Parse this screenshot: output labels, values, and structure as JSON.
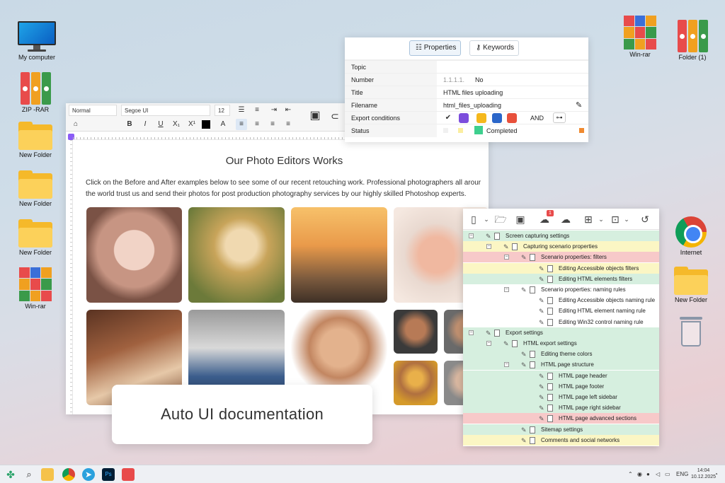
{
  "desktop": {
    "left_icons": [
      {
        "label": "My computer"
      },
      {
        "label": "ZIP -RAR"
      },
      {
        "label": "New Folder"
      },
      {
        "label": "New Folder"
      },
      {
        "label": "New Folder"
      },
      {
        "label": "Win-rar"
      }
    ],
    "right_icons": [
      {
        "label": "Win-rar"
      },
      {
        "label": "Folder (1)"
      },
      {
        "label": "Internet"
      },
      {
        "label": "New Folder"
      },
      {
        "label": ""
      }
    ]
  },
  "editor": {
    "style_select": "Normal",
    "font_select": "Segoe UI",
    "size_select": "12",
    "format_buttons": [
      "B",
      "I",
      "U",
      "X₁",
      "X¹",
      "A"
    ],
    "doc_title": "Our Photo Editors Works",
    "doc_body_line1": "Click on the Before and After examples below to see some of our recent retouching work. Professional photographers all arour",
    "doc_body_line2": "the world trust us and send their photos for post production photography services by our highly skilled Photoshop experts."
  },
  "properties": {
    "tab_properties": "Properties",
    "tab_keywords": "Keywords",
    "rows": [
      {
        "key": "Topic",
        "value": ""
      },
      {
        "key": "Number",
        "value": "No",
        "prefix": "1.1.1.1."
      },
      {
        "key": "Title",
        "value": "HTML files uploading"
      },
      {
        "key": "Filename",
        "value": "html_files_uploading"
      },
      {
        "key": "Export conditions",
        "value": "AND"
      },
      {
        "key": "Status",
        "value": "Completed"
      }
    ]
  },
  "tree": {
    "badge": "1",
    "items": [
      {
        "label": "Screen capturing settings",
        "color": "g"
      },
      {
        "label": "Capturing scenario properties",
        "color": "y"
      },
      {
        "label": "Scenario properties: filters",
        "color": "r"
      },
      {
        "label": "Editing Accessible objects filters",
        "color": "y"
      },
      {
        "label": "Editing HTML elements filters",
        "color": "g"
      },
      {
        "label": "Scenario properties: naming rules",
        "color": "w"
      },
      {
        "label": "Editing Accessible objects naming rule",
        "color": "w"
      },
      {
        "label": "Editing HTML element naming rule",
        "color": "w"
      },
      {
        "label": "Editing Win32 control naming rule",
        "color": "w"
      },
      {
        "label": "Export settings",
        "color": "g"
      },
      {
        "label": "HTML export settings",
        "color": "g"
      },
      {
        "label": "Editing theme colors",
        "color": "g"
      },
      {
        "label": "HTML page structure",
        "color": "g"
      },
      {
        "label": "HTML page header",
        "color": "g"
      },
      {
        "label": "HTML page footer",
        "color": "g"
      },
      {
        "label": "HTML page left sidebar",
        "color": "g"
      },
      {
        "label": "HTML page right sidebar",
        "color": "g"
      },
      {
        "label": "HTML page advanced sections",
        "color": "r"
      },
      {
        "label": "Sitemap settings",
        "color": "g"
      },
      {
        "label": "Comments and social networks",
        "color": "y"
      }
    ]
  },
  "banner": {
    "text": "Auto UI documentation"
  },
  "taskbar": {
    "lang": "ENG",
    "time": "14:04",
    "date": "10.12.2025",
    "ps_label": "Ps"
  },
  "colors": {
    "status_completed": "#3ecf8e",
    "accent": "#2f7ed8"
  }
}
